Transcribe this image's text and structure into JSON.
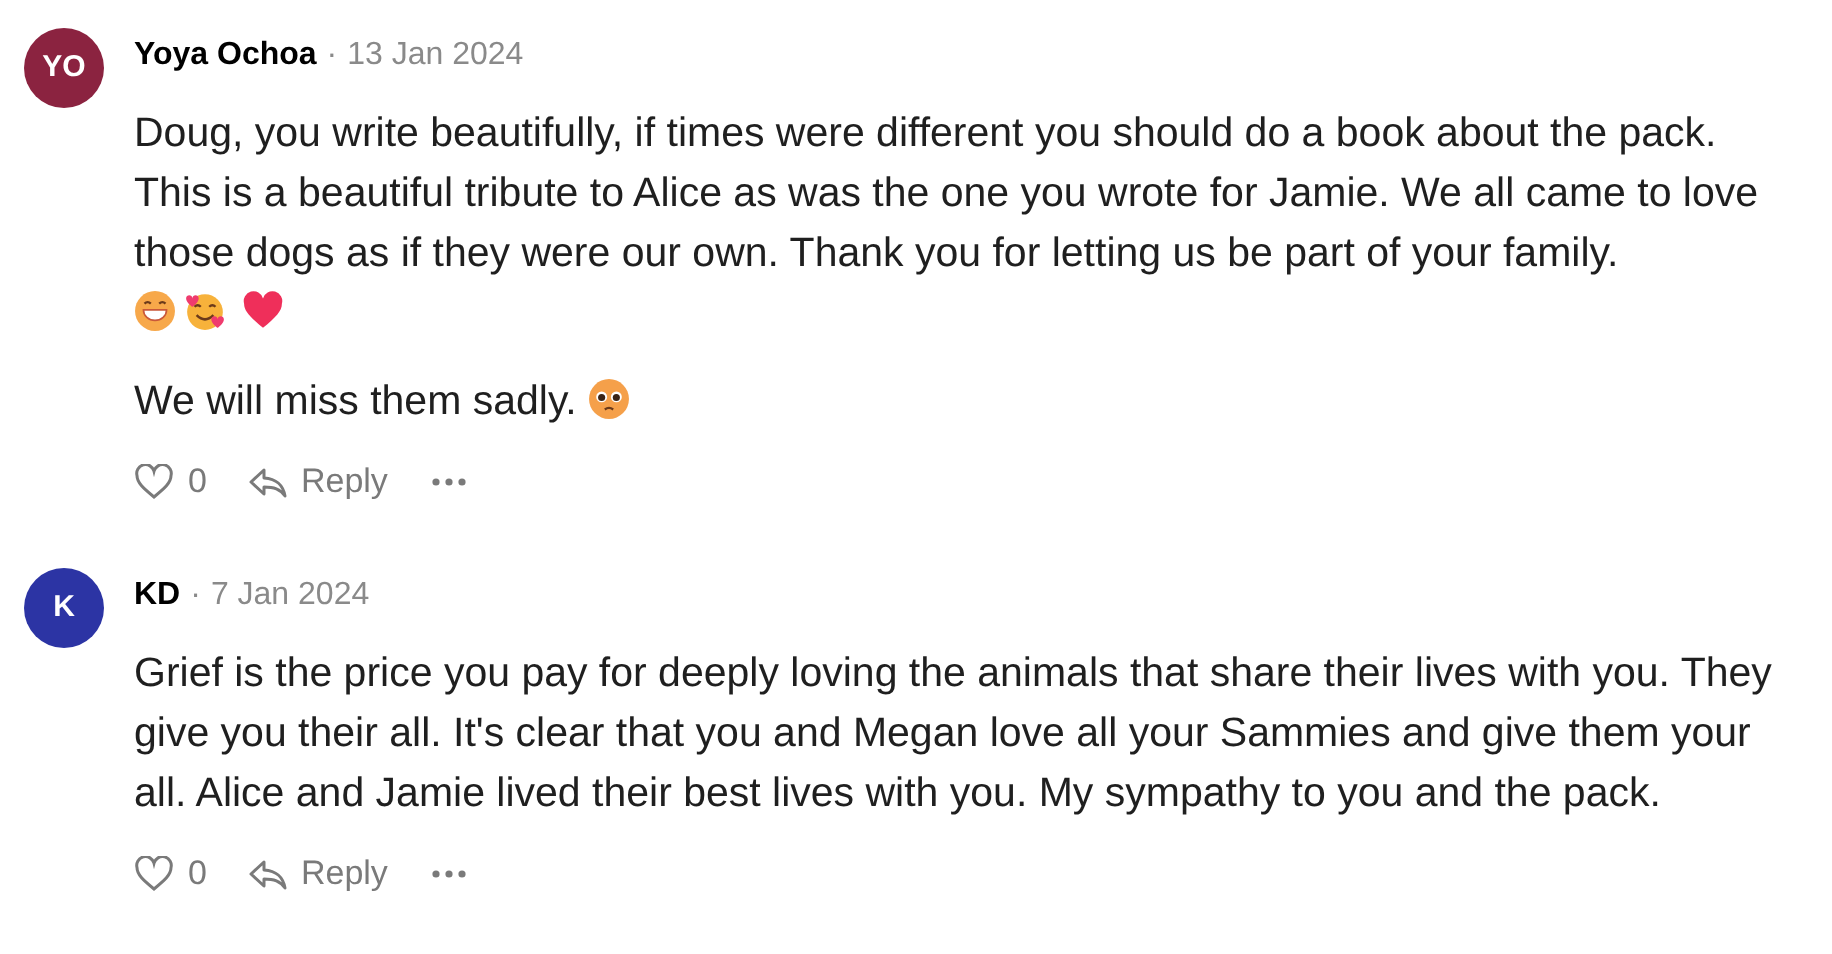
{
  "comments": [
    {
      "initials": "YO",
      "color": "#8b2340",
      "author": "Yoya Ochoa",
      "separator": "·",
      "date": "13 Jan 2024",
      "paragraphs": [
        [
          {
            "kind": "text",
            "text": "Doug, you write beautifully, if times were different you should do a book about the pack. This is a beautiful tribute to Alice as was the one you wrote for Jamie. We all came to love those dogs as if they were our own. Thank you for letting us be part of your family."
          },
          {
            "kind": "grin"
          },
          {
            "kind": "hearts-face"
          },
          {
            "kind": "heart"
          }
        ],
        [
          {
            "kind": "text",
            "text": "We will miss them sadly."
          },
          {
            "kind": "pleading"
          }
        ]
      ],
      "likes": "0",
      "reply": "Reply"
    },
    {
      "initials": "K",
      "color": "#2c34a4",
      "author": "KD",
      "separator": "·",
      "date": "7 Jan 2024",
      "paragraphs": [
        [
          {
            "kind": "text",
            "text": "Grief is the price you pay for deeply loving the animals that share their lives with you. They give you their all. It's clear that you and Megan love all your Sammies and give them your all. Alice and Jamie lived their best lives with you. My sympathy to you and the pack."
          }
        ]
      ],
      "likes": "0",
      "reply": "Reply"
    }
  ]
}
